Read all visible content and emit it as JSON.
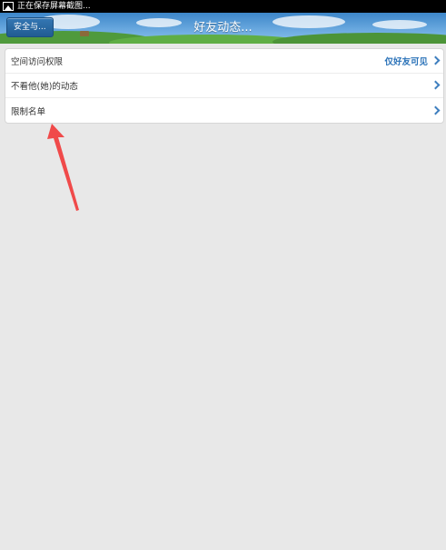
{
  "status_bar": {
    "notification_text": "正在保存屏幕截图..."
  },
  "header": {
    "back_label": "安全与...",
    "title": "好友动态..."
  },
  "menu": {
    "items": [
      {
        "label": "空间访问权限",
        "value": "仅好友可见"
      },
      {
        "label": "不看他(她)的动态",
        "value": ""
      },
      {
        "label": "限制名单",
        "value": ""
      }
    ]
  },
  "colors": {
    "accent": "#2a72b8",
    "annotation_arrow": "#f04a4a",
    "background": "#e8e8e8"
  },
  "icons": {
    "status": "image-icon",
    "row_chevron": "chevron-right-icon"
  }
}
